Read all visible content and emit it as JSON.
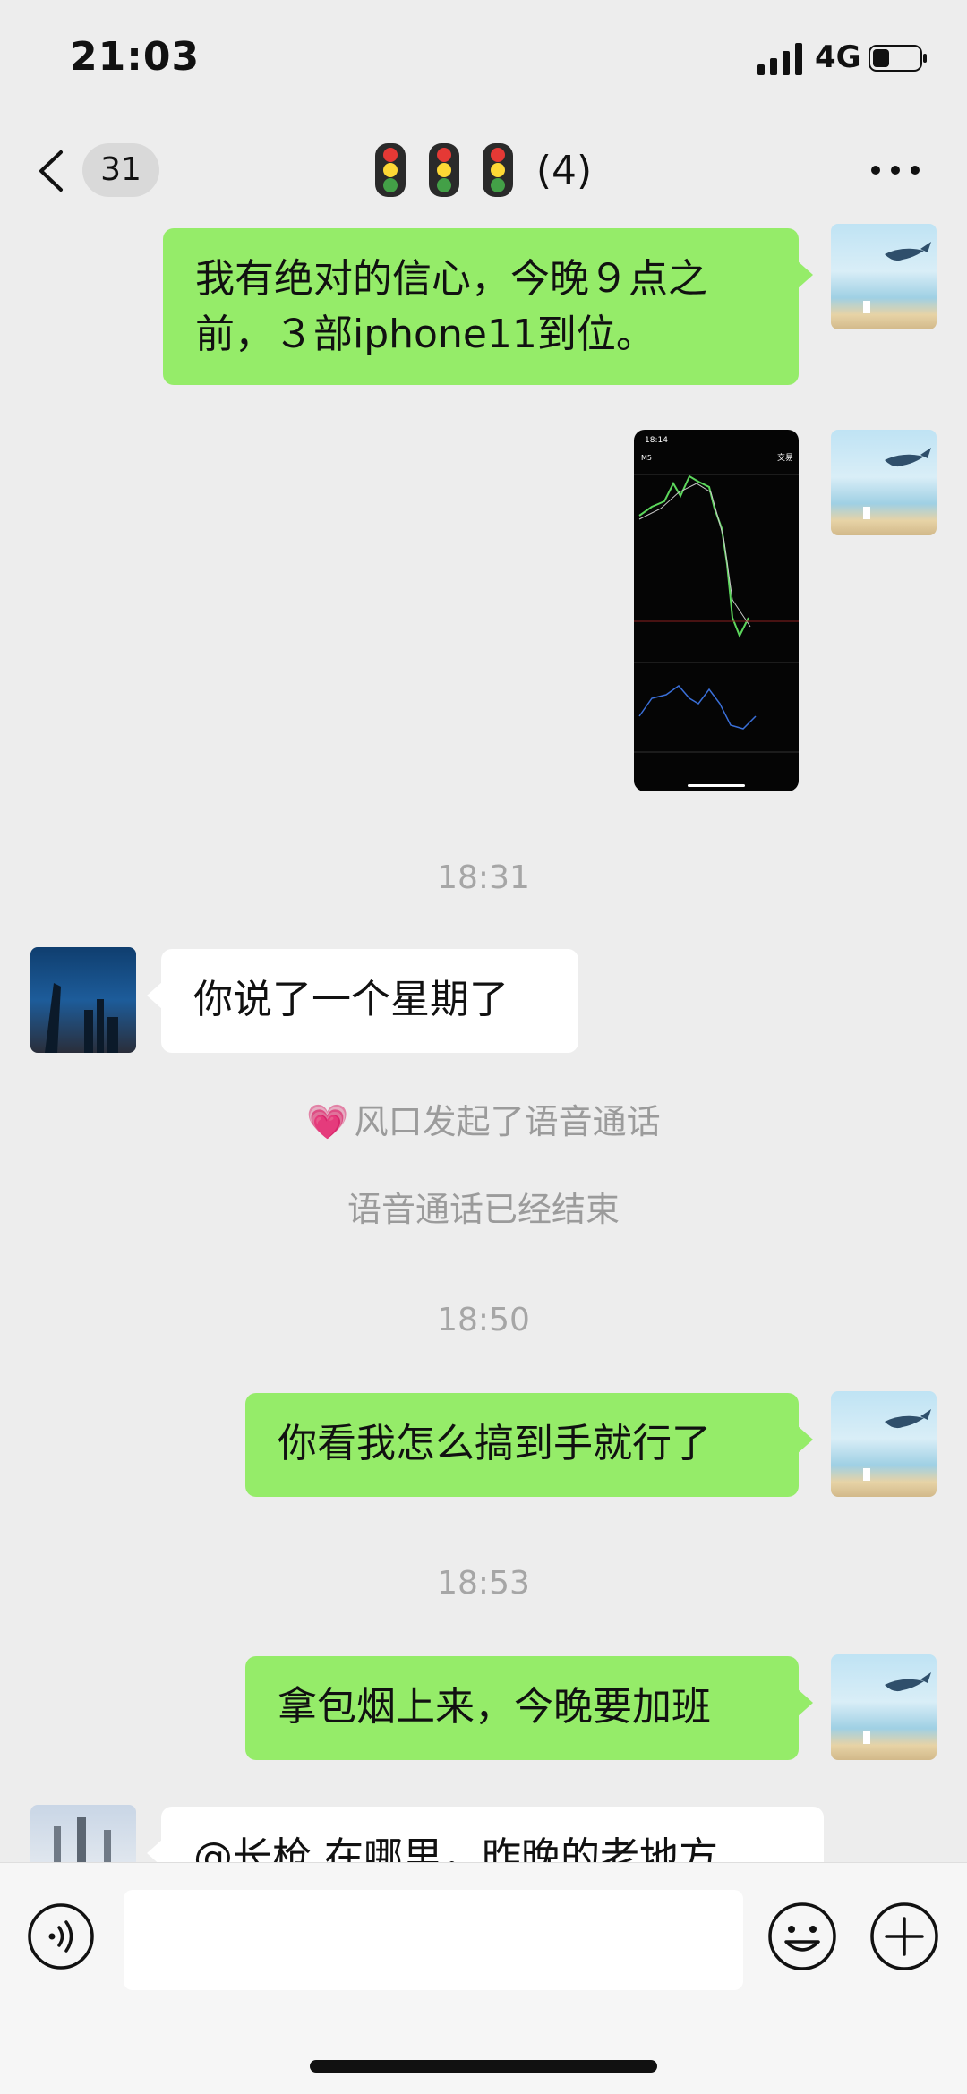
{
  "status_bar": {
    "time": "21:03",
    "network": "4G"
  },
  "header": {
    "unread_count": "31",
    "title_count": "(4)"
  },
  "messages": [
    {
      "text": "我有绝对的信心，今晚９点之前，３部iphone11到位。"
    },
    {
      "text": "你说了一个星期了"
    },
    {
      "text": "你看我怎么搞到手就行了"
    },
    {
      "text": "拿包烟上来，今晚要加班"
    },
    {
      "text": "@长枪 在哪里，昨晚的老地方"
    }
  ],
  "timestamps": [
    "18:31",
    "18:50",
    "18:53"
  ],
  "system_messages": [
    "风口发起了语音通话",
    "语音通话已经结束"
  ],
  "chart_image": {
    "top_left": "18:14",
    "top_right": "交易",
    "symbol": "M5"
  },
  "colors": {
    "outgoing_bubble": "#95ec69",
    "incoming_bubble": "#ffffff",
    "background": "#ededed"
  }
}
